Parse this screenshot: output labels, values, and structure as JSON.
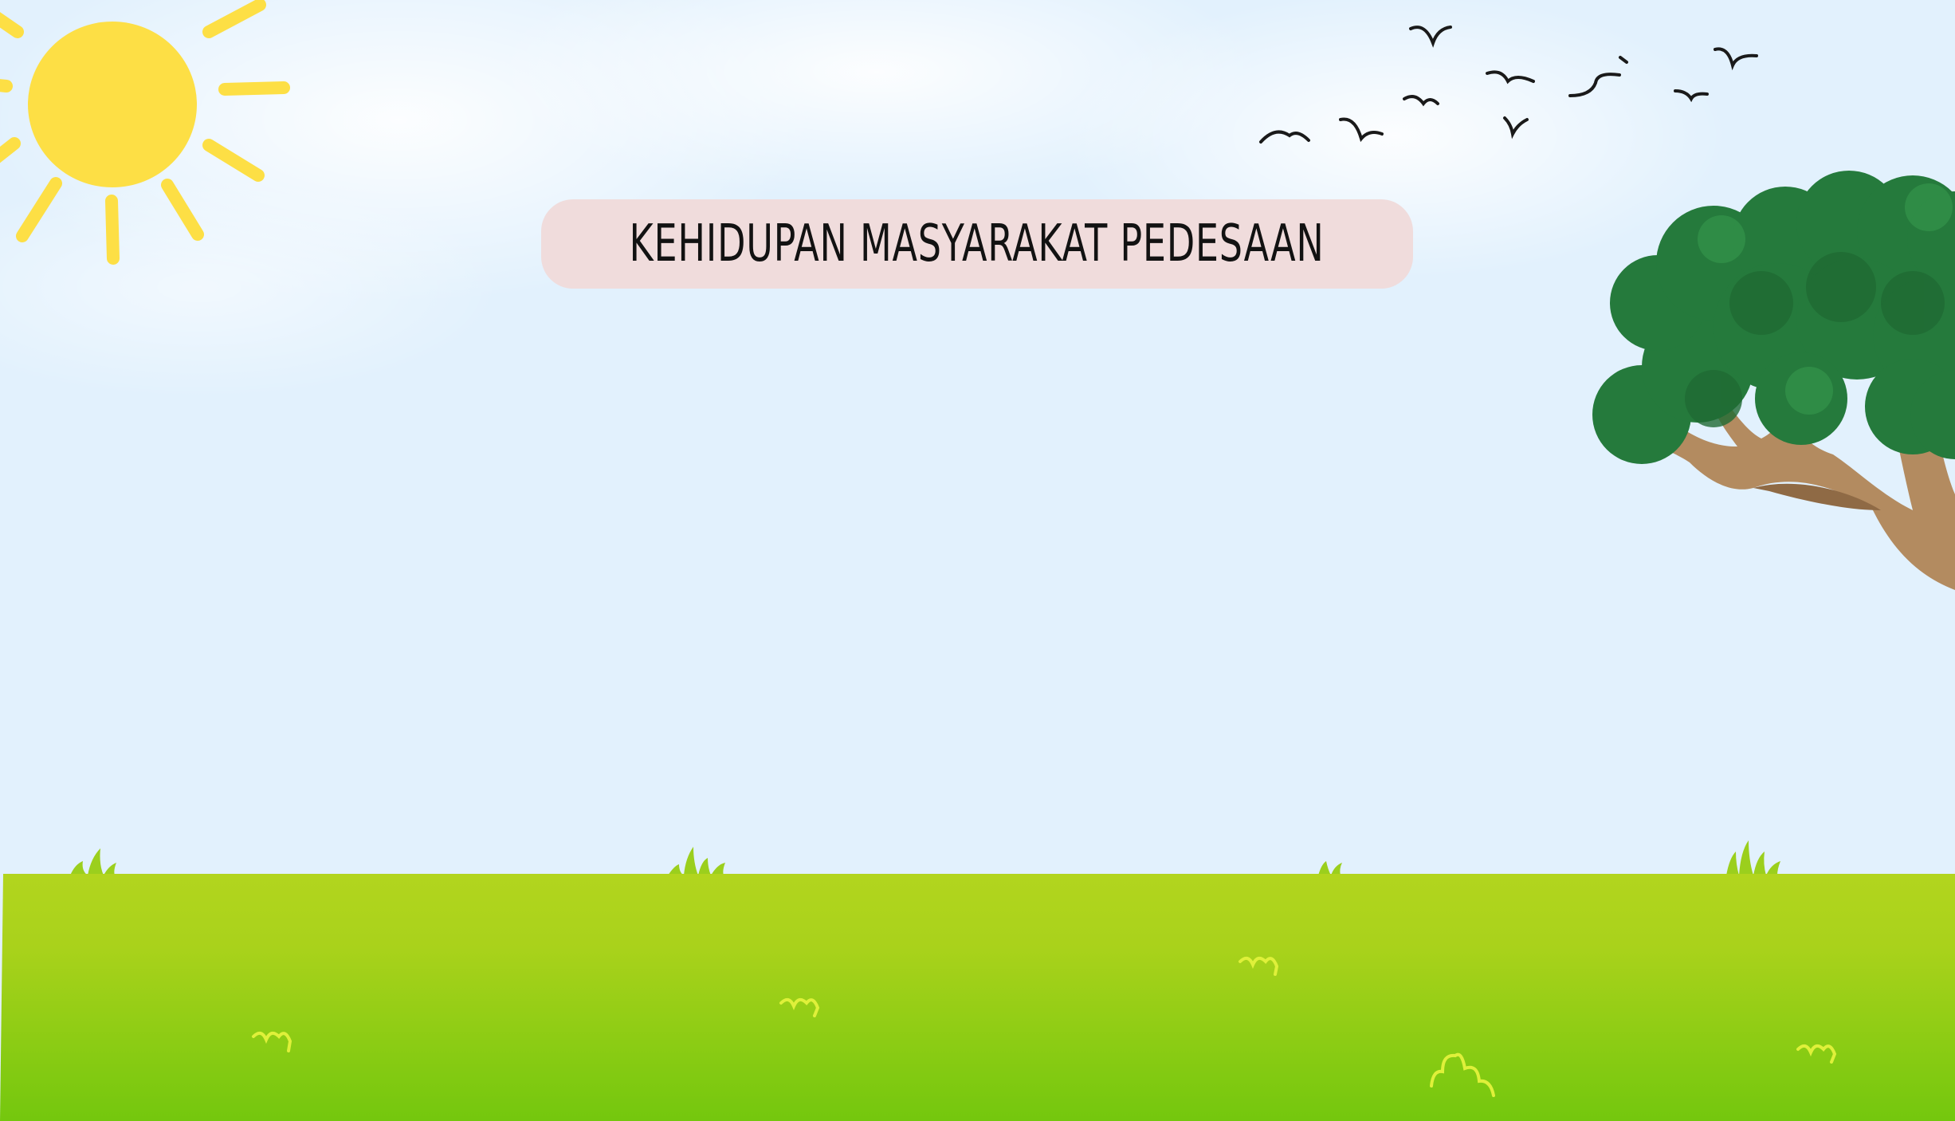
{
  "title": "KEHIDUPAN MASYARAKAT PEDESAAN",
  "colors": {
    "sky": "#e2f1fd",
    "sun": "#fddf45",
    "grass_top": "#b1d41f",
    "grass_bottom": "#74c70e",
    "title_pill": "#f0dcdc",
    "tree_leaves": "#2a7a3e",
    "tree_trunk": "#b08a5f",
    "birds": "#1a1a1a"
  },
  "icons": [
    "sun-icon",
    "bird-icon",
    "tree-icon",
    "grass-tuft-icon"
  ]
}
